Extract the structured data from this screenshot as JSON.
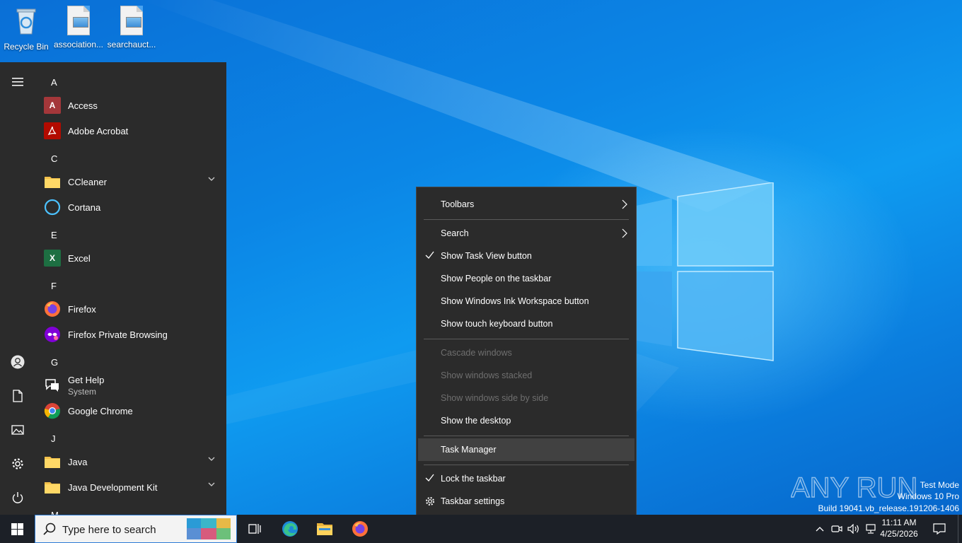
{
  "desktop": {
    "icons": [
      {
        "label": "Recycle Bin",
        "icon": "recycle-bin-icon"
      },
      {
        "label": "association...",
        "icon": "image-file-icon"
      },
      {
        "label": "searchauct...",
        "icon": "image-file-icon"
      }
    ]
  },
  "start_menu": {
    "rail": [
      "hamburger-icon",
      "user-icon",
      "documents-icon",
      "pictures-icon",
      "settings-icon",
      "power-icon"
    ],
    "groups": [
      {
        "letter": "A"
      },
      {
        "letter": "C"
      },
      {
        "letter": "E"
      },
      {
        "letter": "F"
      },
      {
        "letter": "G"
      },
      {
        "letter": "J"
      },
      {
        "letter": "M"
      }
    ],
    "apps": [
      {
        "label": "Access",
        "icon_text": "A",
        "color": "#a4373a"
      },
      {
        "label": "Adobe Acrobat",
        "icon_text": "",
        "color": "#b30b00"
      },
      {
        "label": "CCleaner",
        "color": "#e8b84a"
      },
      {
        "label": "Cortana",
        "color": "#4cc2ff"
      },
      {
        "label": "Excel",
        "icon_text": "X",
        "color": "#1d6f42"
      },
      {
        "label": "Firefox",
        "color": "#ff7139"
      },
      {
        "label": "Firefox Private Browsing",
        "color": "#8000d7"
      },
      {
        "label": "Get Help",
        "sub": "System",
        "color": "#ffffff"
      },
      {
        "label": "Google Chrome",
        "color": "#4285f4"
      },
      {
        "label": "Java",
        "color": "#e8b84a"
      },
      {
        "label": "Java Development Kit",
        "color": "#e8b84a"
      }
    ]
  },
  "context_menu": {
    "items": [
      {
        "label": "Toolbars",
        "submenu": true
      },
      {
        "label": "Search",
        "submenu": true
      },
      {
        "label": "Show Task View button",
        "checked": true
      },
      {
        "label": "Show People on the taskbar"
      },
      {
        "label": "Show Windows Ink Workspace button"
      },
      {
        "label": "Show touch keyboard button"
      },
      {
        "label": "Cascade windows",
        "disabled": true
      },
      {
        "label": "Show windows stacked",
        "disabled": true
      },
      {
        "label": "Show windows side by side",
        "disabled": true
      },
      {
        "label": "Show the desktop"
      },
      {
        "label": "Task Manager",
        "highlighted": true
      },
      {
        "label": "Lock the taskbar",
        "checked": true
      },
      {
        "label": "Taskbar settings",
        "icon": "gear-icon"
      }
    ]
  },
  "watermark": {
    "brand": "ANY RUN",
    "lines": [
      "Test Mode",
      "Windows 10 Pro",
      "Build 19041.vb_release.191206-1406"
    ]
  },
  "taskbar": {
    "search_placeholder": "Type here to search",
    "pinned": [
      "task-view-icon",
      "edge-icon",
      "file-explorer-icon",
      "firefox-icon"
    ],
    "clock": {
      "time": "11:11 AM",
      "date": "4/25/2026"
    }
  },
  "colors": {
    "accent": "#0078d7",
    "menu_bg": "#2b2b2b",
    "taskbar_bg": "#1c2027"
  }
}
